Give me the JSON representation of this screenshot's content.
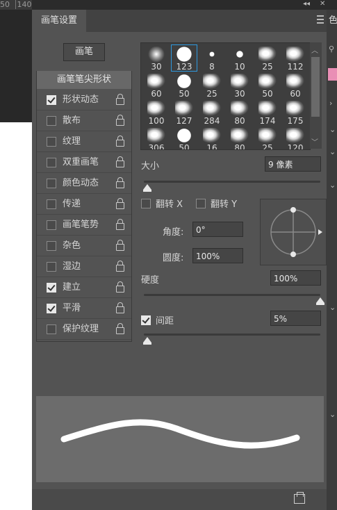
{
  "ruler": {
    "left_num": "50",
    "right_num": "140"
  },
  "panel": {
    "tab_label": "画笔设置"
  },
  "right_strip": {
    "char": "色"
  },
  "brush_button_label": "画笔",
  "options": {
    "header": "画笔笔尖形状",
    "items": [
      {
        "label": "形状动态",
        "checked": true
      },
      {
        "label": "散布",
        "checked": false
      },
      {
        "label": "纹理",
        "checked": false
      },
      {
        "label": "双重画笔",
        "checked": false
      },
      {
        "label": "颜色动态",
        "checked": false
      },
      {
        "label": "传递",
        "checked": false
      },
      {
        "label": "画笔笔势",
        "checked": false
      },
      {
        "label": "杂色",
        "checked": false
      },
      {
        "label": "湿边",
        "checked": false
      },
      {
        "label": "建立",
        "checked": true
      },
      {
        "label": "平滑",
        "checked": true
      },
      {
        "label": "保护纹理",
        "checked": false
      }
    ]
  },
  "brush_grid": {
    "selected_index": 1,
    "sizes": [
      "30",
      "123",
      "8",
      "10",
      "25",
      "112",
      "60",
      "50",
      "25",
      "30",
      "50",
      "60",
      "100",
      "127",
      "284",
      "80",
      "174",
      "175",
      "306",
      "50",
      "16",
      "80",
      "25",
      "120"
    ]
  },
  "size": {
    "label": "大小",
    "value": "9 像素",
    "fraction": 0.02
  },
  "flip_x": {
    "label": "翻转 X",
    "checked": false
  },
  "flip_y": {
    "label": "翻转 Y",
    "checked": false
  },
  "angle": {
    "label": "角度:",
    "value": "0°"
  },
  "roundness": {
    "label": "圆度:",
    "value": "100%"
  },
  "hardness": {
    "label": "硬度",
    "value": "100%",
    "fraction": 1.0
  },
  "spacing": {
    "label": "间距",
    "value": "5%",
    "checked": true,
    "fraction": 0.02
  }
}
